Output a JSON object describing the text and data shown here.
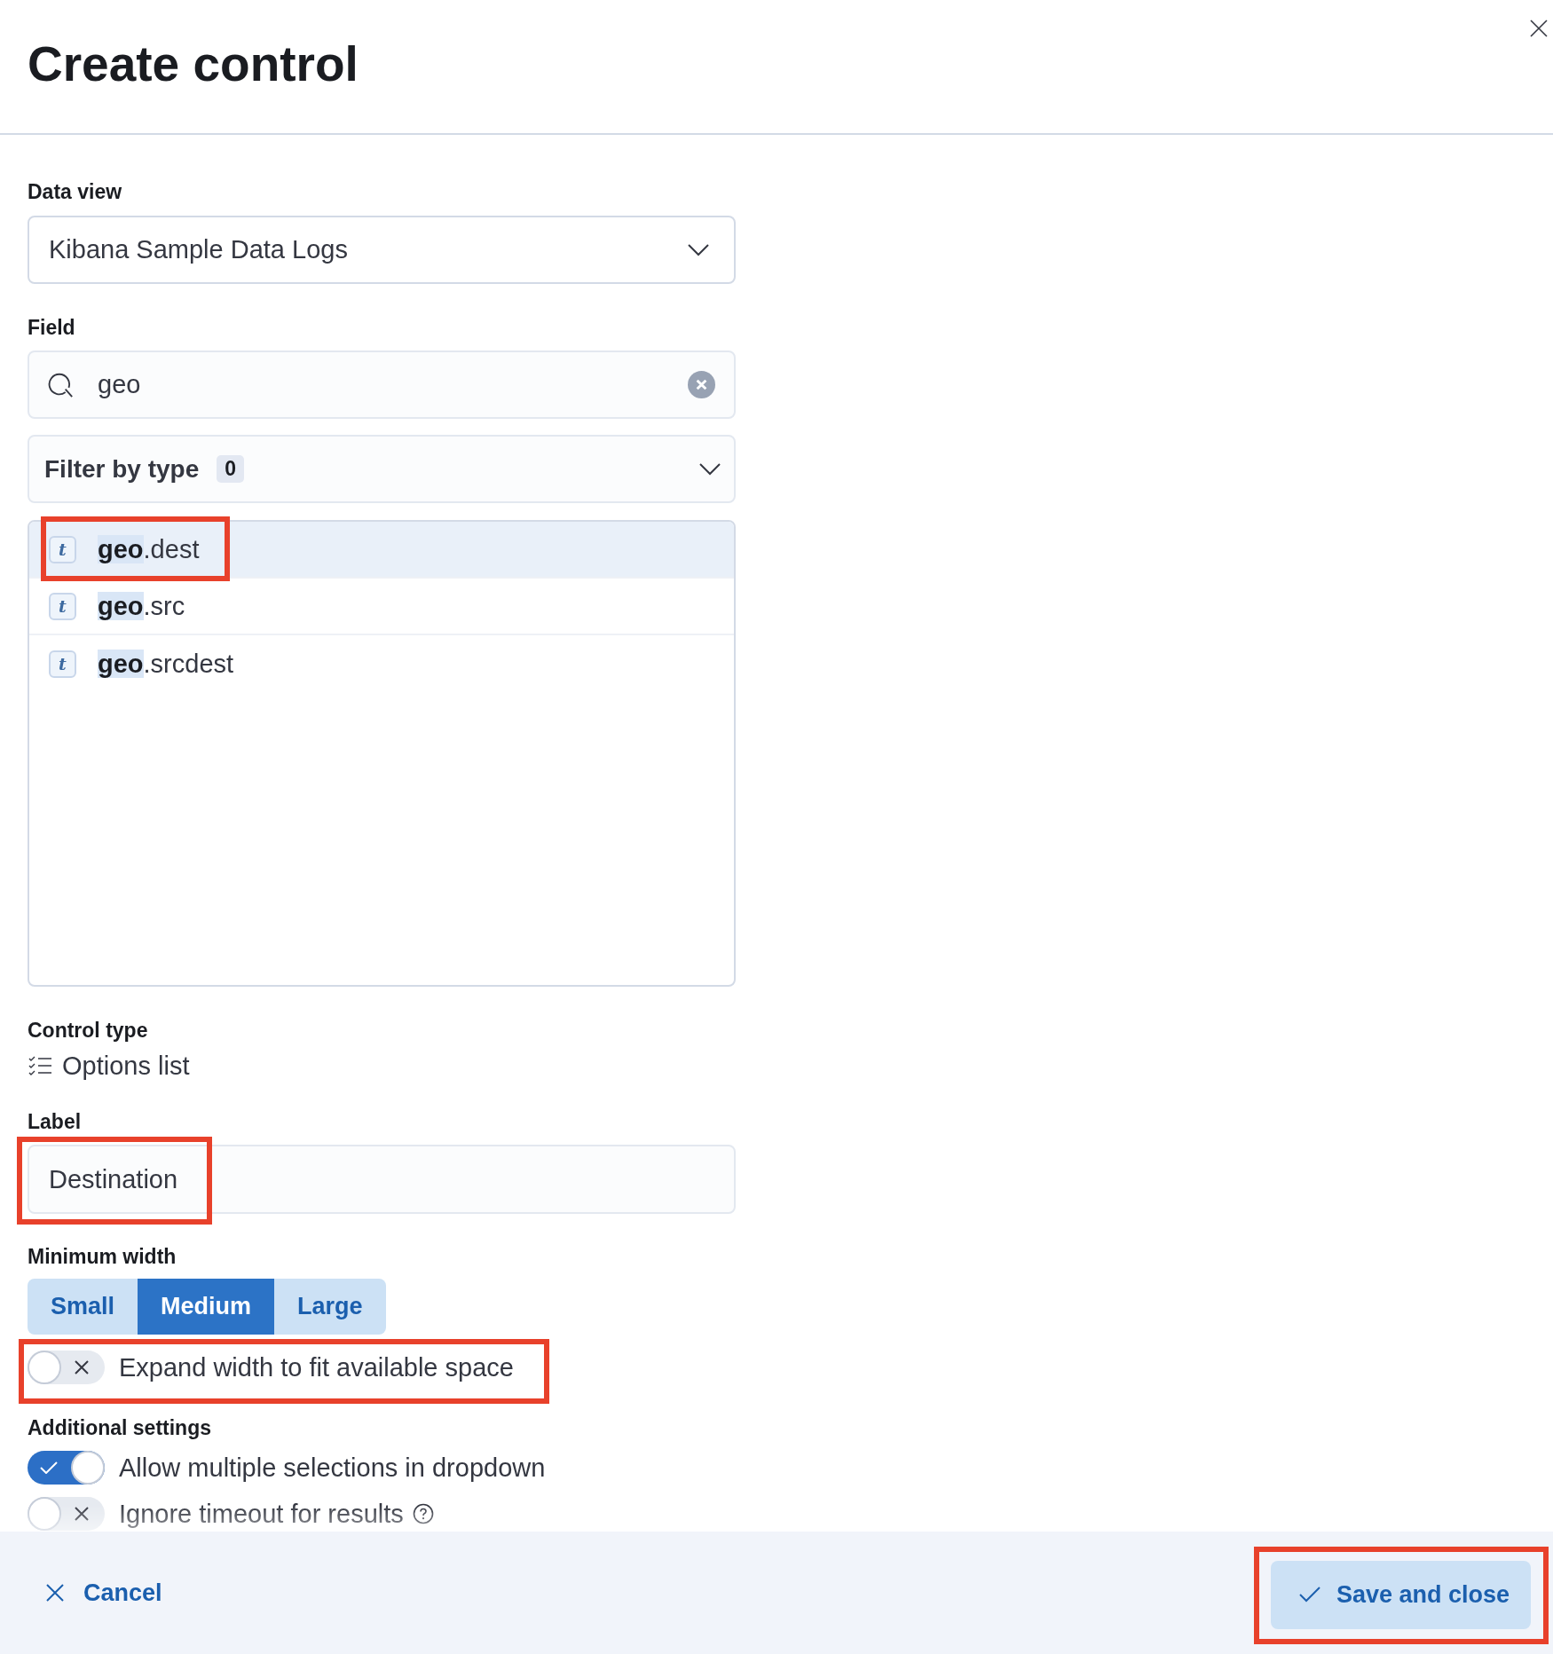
{
  "flyout": {
    "title": "Create control"
  },
  "form": {
    "data_view": {
      "label": "Data view",
      "value": "Kibana Sample Data Logs"
    },
    "field": {
      "label": "Field",
      "search": {
        "value": "geo"
      },
      "filter": {
        "label": "Filter by type",
        "count": "0"
      },
      "options": [
        {
          "token": "t",
          "label": "**geo**.dest",
          "selected": true,
          "highlighted": true
        },
        {
          "token": "t",
          "label": "**geo**.src",
          "selected": false,
          "highlighted": false
        },
        {
          "token": "t",
          "label": "**geo**.srcdest",
          "selected": false,
          "highlighted": false
        }
      ]
    },
    "control_type": {
      "label": "Control type",
      "value": "Options list"
    },
    "label": {
      "label": "Label",
      "value": "Destination",
      "highlighted": true
    },
    "minimum_width": {
      "label": "Minimum width",
      "options": [
        {
          "label": "Small",
          "selected": false
        },
        {
          "label": "Medium",
          "selected": true
        },
        {
          "label": "Large",
          "selected": false
        }
      ],
      "expand": {
        "label": "Expand width to fit available space",
        "on": false,
        "highlighted": true
      }
    },
    "additional_settings": {
      "label": "Additional settings",
      "switches": [
        {
          "label": "Allow multiple selections in dropdown",
          "on": true
        },
        {
          "label": "Ignore timeout for results",
          "on": false,
          "help": true
        }
      ]
    }
  },
  "footer": {
    "cancel": "Cancel",
    "save": {
      "label": "Save and close",
      "highlighted": true
    }
  }
}
